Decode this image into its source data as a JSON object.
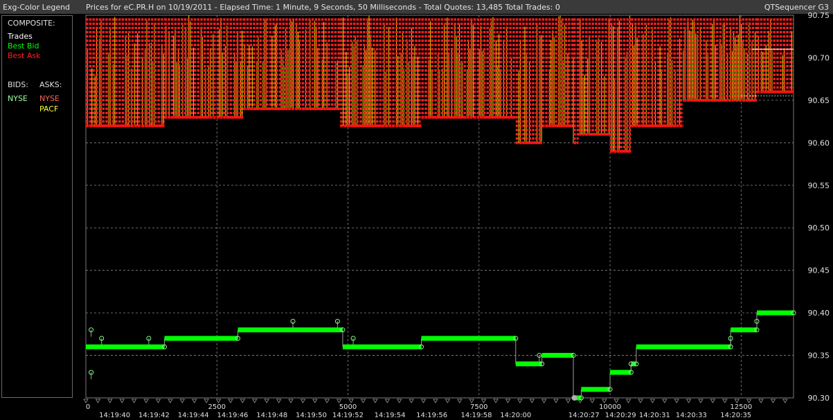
{
  "titlebar": {
    "legend_title": "Exg-Color Legend",
    "chart_title": "Prices for  eC.PR.H  on  10/19/2011  -  Elapsed Time: 1 Minute, 9 Seconds, 50 Milliseconds  -  Total Quotes: 13,485  Total Trades: 0",
    "app_name": "QTSequencer G3"
  },
  "legend": {
    "composite_label": "COMPOSITE:",
    "trades_label": "Trades",
    "best_bid_label": "Best Bid",
    "best_ask_label": "Best Ask",
    "bids_label": "BIDS:",
    "asks_label": "ASKS:",
    "bid_exchanges": [
      "NYSE"
    ],
    "ask_exchanges": [
      "NYSE",
      "PACF"
    ],
    "colors": {
      "trades": "#ffffff",
      "best_bid": "#00ff00",
      "best_ask": "#ff2020",
      "bid_nyse": "#a0ffa0",
      "ask_nyse": "#ff6060",
      "ask_pacf": "#ffff40"
    }
  },
  "chart_data": {
    "type": "line",
    "title": "Prices for  eC.PR.H  on  10/19/2011",
    "ylim": [
      90.3,
      90.75
    ],
    "y_ticks": [
      "90.30",
      "90.35",
      "90.40",
      "90.45",
      "90.50",
      "90.55",
      "90.60",
      "90.65",
      "90.70",
      "90.75"
    ],
    "xlim": [
      0,
      13500
    ],
    "x_ticks": [
      0,
      2500,
      5000,
      7500,
      10000,
      12500
    ],
    "x_tick_labels": [
      "0",
      "2500",
      "5000",
      "7500",
      "10000",
      "12500"
    ],
    "time_labels": [
      "14:19:40",
      "14:19:42",
      "14:19:44",
      "14:19:46",
      "14:19:48",
      "14:19:50",
      "14:19:52",
      "14:19:54",
      "14:19:56",
      "14:19:58",
      "14:20:00",
      "14:20:27",
      "14:20:29",
      "14:20:31",
      "14:20:33",
      "14:20:35"
    ],
    "time_label_positions": [
      550,
      1300,
      2050,
      2800,
      3550,
      4300,
      5000,
      5800,
      6600,
      7450,
      8200,
      9500,
      10200,
      10850,
      11550,
      12400
    ],
    "series": [
      {
        "name": "Best Bid",
        "color": "#00ff00",
        "steps": [
          {
            "x0": 0,
            "x1": 1500,
            "y": 90.36
          },
          {
            "x0": 1500,
            "x1": 2900,
            "y": 90.37
          },
          {
            "x0": 2900,
            "x1": 4900,
            "y": 90.38
          },
          {
            "x0": 4900,
            "x1": 6400,
            "y": 90.36
          },
          {
            "x0": 6400,
            "x1": 8200,
            "y": 90.37
          },
          {
            "x0": 8200,
            "x1": 8700,
            "y": 90.34
          },
          {
            "x0": 8700,
            "x1": 9300,
            "y": 90.35
          },
          {
            "x0": 9300,
            "x1": 9450,
            "y": 90.3
          },
          {
            "x0": 9450,
            "x1": 10000,
            "y": 90.31
          },
          {
            "x0": 10000,
            "x1": 10400,
            "y": 90.33
          },
          {
            "x0": 10400,
            "x1": 10500,
            "y": 90.34
          },
          {
            "x0": 10500,
            "x1": 12300,
            "y": 90.36
          },
          {
            "x0": 12300,
            "x1": 12800,
            "y": 90.38
          },
          {
            "x0": 12800,
            "x1": 13500,
            "y": 90.4
          }
        ]
      },
      {
        "name": "Best Ask",
        "color": "#ff2020",
        "levels": [
          {
            "x0": 0,
            "x1": 1500,
            "y": 90.62
          },
          {
            "x0": 1500,
            "x1": 3000,
            "y": 90.63
          },
          {
            "x0": 3000,
            "x1": 4850,
            "y": 90.64
          },
          {
            "x0": 4850,
            "x1": 6400,
            "y": 90.62
          },
          {
            "x0": 6400,
            "x1": 8200,
            "y": 90.63
          },
          {
            "x0": 8200,
            "x1": 8700,
            "y": 90.6
          },
          {
            "x0": 8700,
            "x1": 9300,
            "y": 90.62
          },
          {
            "x0": 9300,
            "x1": 9400,
            "y": 90.6
          },
          {
            "x0": 9400,
            "x1": 10000,
            "y": 90.61
          },
          {
            "x0": 10000,
            "x1": 10400,
            "y": 90.59
          },
          {
            "x0": 10400,
            "x1": 11400,
            "y": 90.62
          },
          {
            "x0": 11400,
            "x1": 12800,
            "y": 90.65
          },
          {
            "x0": 12800,
            "x1": 13500,
            "y": 90.66
          }
        ]
      }
    ]
  }
}
